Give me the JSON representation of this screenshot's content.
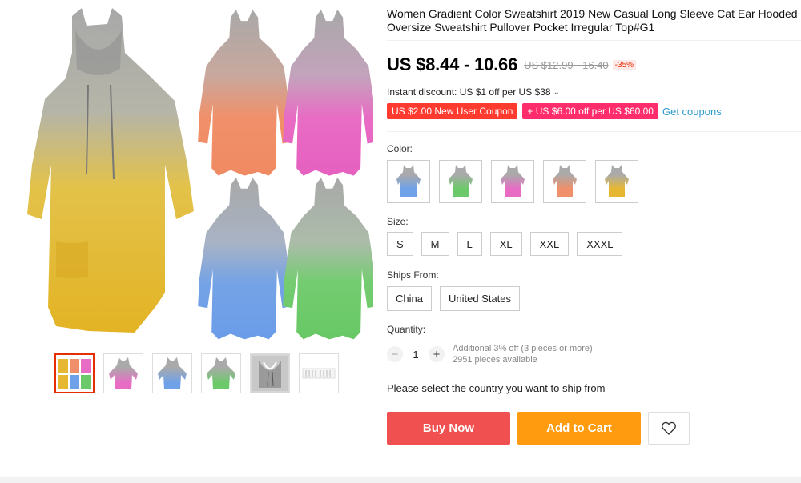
{
  "product": {
    "title": "Women Gradient Color Sweatshirt 2019 New Casual Long Sleeve Cat Ear Hooded Oversize Sweatshirt Pullover Pocket Irregular Top#G1",
    "price": "US $8.44 - 10.66",
    "original_price": "US $12.99 - 16.40",
    "discount": "-35%",
    "instant_discount": "Instant discount: US $1 off per US $38",
    "coupons": [
      "US $2.00 New User Coupon",
      "+ US $6.00 off per US $60.00"
    ],
    "get_coupons": "Get coupons"
  },
  "gallery": {
    "selected_index": 0,
    "thumbnails": [
      "multi",
      "pink",
      "blue",
      "green",
      "detail",
      "size-chart"
    ]
  },
  "options": {
    "color_label": "Color:",
    "colors": [
      {
        "name": "blue",
        "hex": "#6fa1e8"
      },
      {
        "name": "green",
        "hex": "#6cc96a"
      },
      {
        "name": "pink",
        "hex": "#e86cc4"
      },
      {
        "name": "orange",
        "hex": "#f0906a"
      },
      {
        "name": "yellow",
        "hex": "#e6b832"
      }
    ],
    "size_label": "Size:",
    "sizes": [
      "S",
      "M",
      "L",
      "XL",
      "XXL",
      "XXXL"
    ],
    "ships_label": "Ships From:",
    "ships_from": [
      "China",
      "United States"
    ]
  },
  "quantity": {
    "label": "Quantity:",
    "value": "1",
    "minus": "−",
    "plus": "+",
    "note_line1": "Additional 3% off (3 pieces or more)",
    "note_line2": "2951 pieces available"
  },
  "ship_message": "Please select the country you want to ship from",
  "actions": {
    "buy_now": "Buy Now",
    "add_to_cart": "Add to Cart"
  },
  "colors": {
    "gray": "#a9a9a9",
    "yellow": "#e6b832",
    "orange": "#f0906a",
    "pink": "#e86cc4",
    "blue": "#6fa1e8",
    "green": "#6cc96a",
    "buy_now_bg": "#f0504f",
    "add_cart_bg": "#ff9b0f",
    "link": "#2e9ad0"
  }
}
